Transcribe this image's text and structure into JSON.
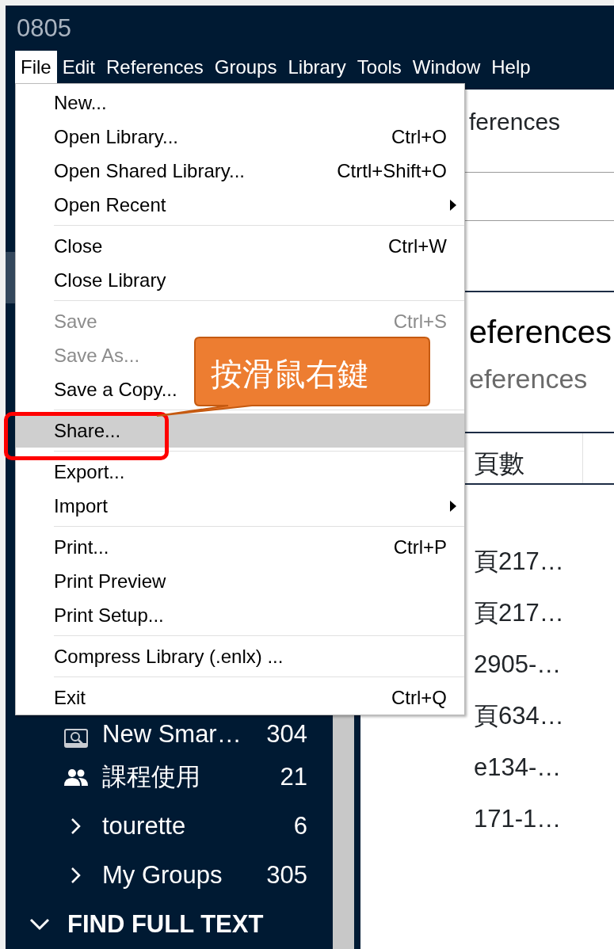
{
  "window": {
    "title": "0805"
  },
  "menu_bar": [
    {
      "label": "File",
      "selected": true
    },
    {
      "label": "Edit",
      "selected": false
    },
    {
      "label": "References",
      "selected": false
    },
    {
      "label": "Groups",
      "selected": false
    },
    {
      "label": "Library",
      "selected": false
    },
    {
      "label": "Tools",
      "selected": false
    },
    {
      "label": "Window",
      "selected": false
    },
    {
      "label": "Help",
      "selected": false
    }
  ],
  "file_menu": [
    [
      {
        "label": "New...",
        "disabled": false,
        "selected": false,
        "submenu": false
      },
      {
        "label": "Open Library...",
        "shortcut": "Ctrl+O",
        "disabled": false,
        "selected": false,
        "submenu": false
      },
      {
        "label": "Open Shared Library...",
        "shortcut": "Ctrtl+Shift+O",
        "disabled": false,
        "selected": false,
        "submenu": false
      },
      {
        "label": "Open Recent",
        "disabled": false,
        "selected": false,
        "submenu": true
      }
    ],
    [
      {
        "label": "Close",
        "shortcut": "Ctrl+W",
        "disabled": false,
        "selected": false,
        "submenu": false
      },
      {
        "label": "Close Library",
        "disabled": false,
        "selected": false,
        "submenu": false
      }
    ],
    [
      {
        "label": "Save",
        "shortcut": "Ctrl+S",
        "disabled": true,
        "selected": false,
        "submenu": false
      },
      {
        "label": "Save As...",
        "disabled": true,
        "selected": false,
        "submenu": false
      },
      {
        "label": "Save a Copy...",
        "disabled": false,
        "selected": false,
        "submenu": false
      }
    ],
    [
      {
        "label": "Share...",
        "disabled": false,
        "selected": true,
        "submenu": false
      }
    ],
    [
      {
        "label": "Export...",
        "disabled": false,
        "selected": false,
        "submenu": false
      },
      {
        "label": "Import",
        "disabled": false,
        "selected": false,
        "submenu": true
      }
    ],
    [
      {
        "label": "Print...",
        "shortcut": "Ctrl+P",
        "disabled": false,
        "selected": false,
        "submenu": false
      },
      {
        "label": "Print Preview",
        "disabled": false,
        "selected": false,
        "submenu": false
      },
      {
        "label": "Print Setup...",
        "disabled": false,
        "selected": false,
        "submenu": false
      }
    ],
    [
      {
        "label": "Compress Library (.enlx) ...",
        "disabled": false,
        "selected": false,
        "submenu": false
      }
    ],
    [
      {
        "label": "Exit",
        "shortcut": "Ctrl+Q",
        "disabled": false,
        "selected": false,
        "submenu": false
      }
    ]
  ],
  "callout": {
    "text": "按滑鼠右鍵"
  },
  "sidebar": {
    "items": [
      {
        "kind": "smart",
        "label": "New Smar…",
        "count": "304"
      },
      {
        "kind": "shared",
        "label": "課程使用",
        "count": "21"
      },
      {
        "kind": "group_set",
        "label": "tourette",
        "count": "6",
        "expanded": false
      },
      {
        "kind": "group_set",
        "label": "My Groups",
        "count": "305",
        "expanded": false
      }
    ],
    "section": {
      "label": "FIND FULL TEXT",
      "expanded": true
    }
  },
  "content": {
    "heading": "ferences",
    "library_title": "eferences",
    "library_subtitle": "eferences"
  },
  "table": {
    "columns": [
      "頁數"
    ],
    "rows": [
      {},
      {
        "pages": "頁217…"
      },
      {
        "pages": "頁217…"
      },
      {
        "pages": "2905-…"
      },
      {
        "pages": "頁634…"
      },
      {
        "pages": "e134-…"
      },
      {
        "pages": "171-1…"
      }
    ]
  }
}
